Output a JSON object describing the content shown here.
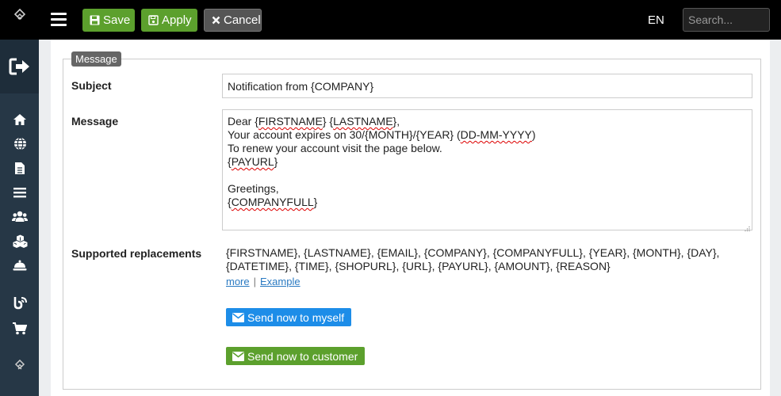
{
  "toolbar": {
    "save_label": "Save",
    "apply_label": "Apply",
    "cancel_label": "Cancel",
    "language": "EN",
    "search_placeholder": "Search..."
  },
  "sidebar": {
    "icons": [
      "logout-icon",
      "home-icon",
      "globe-icon",
      "document-icon",
      "list-icon",
      "users-icon",
      "cubes-icon",
      "bell-icon",
      "blog-icon",
      "cart-icon",
      "logo-icon"
    ]
  },
  "form": {
    "legend": "Message",
    "subject_label": "Subject",
    "subject_value": "Notification from {COMPANY}",
    "message_label": "Message",
    "message_lines": [
      "Dear {FIRSTNAME} {LASTNAME},",
      "Your account expires on 30/{MONTH}/{YEAR} (DD-MM-YYYY)",
      "To renew your account visit the page below.",
      "{PAYURL}",
      "",
      "Greetings,",
      "{COMPANYFULL}"
    ],
    "replacements_label": "Supported replacements",
    "replacements_line1": "{FIRSTNAME}, {LASTNAME}, {EMAIL}, {COMPANY}, {COMPANYFULL}, {YEAR}, {MONTH}, {DAY},",
    "replacements_line2": "{DATETIME}, {TIME}, {SHOPURL}, {URL}, {PAYURL}, {AMOUNT}, {REASON}",
    "more_link": "more",
    "separator": "|",
    "example_link": "Example",
    "send_self_label": "Send now to myself",
    "send_customer_label": "Send now to customer"
  },
  "colors": {
    "topbar": "#000000",
    "sidebar": "#263746",
    "green": "#5ca02d",
    "blue": "#1d8de8",
    "link": "#2a7ac2"
  }
}
